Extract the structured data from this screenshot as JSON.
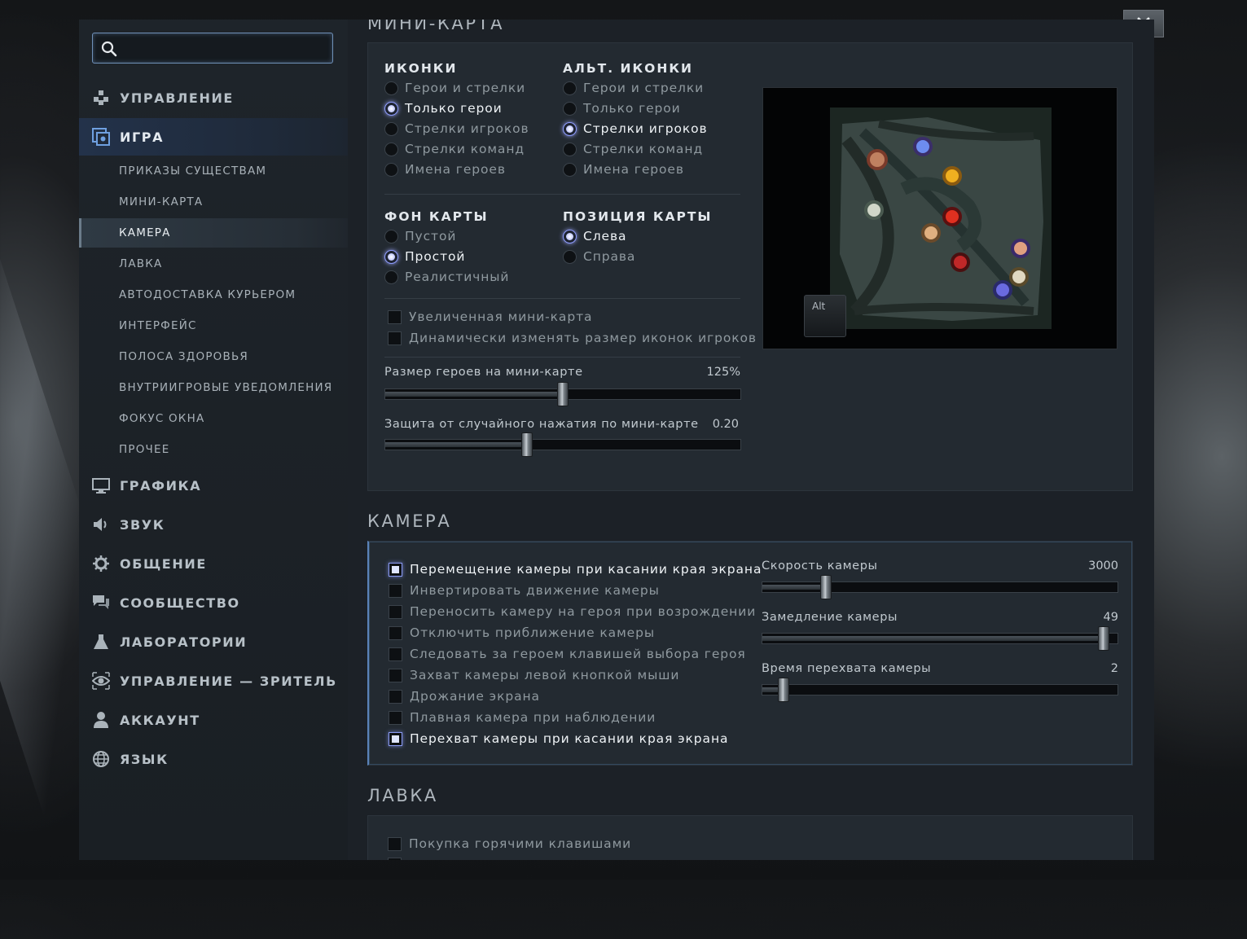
{
  "search": {
    "placeholder": "",
    "value": ""
  },
  "sidebar": {
    "categories": [
      {
        "label": "УПРАВЛЕНИЕ",
        "icon": "controls-icon"
      },
      {
        "label": "ИГРА",
        "icon": "game-icon",
        "active": true
      },
      {
        "label": "ГРАФИКА",
        "icon": "monitor-icon"
      },
      {
        "label": "ЗВУК",
        "icon": "speaker-icon"
      },
      {
        "label": "ОБЩЕНИЕ",
        "icon": "gear-icon"
      },
      {
        "label": "СООБЩЕСТВО",
        "icon": "chat-icon"
      },
      {
        "label": "ЛАБОРАТОРИИ",
        "icon": "flask-icon"
      },
      {
        "label": "УПРАВЛЕНИЕ — ЗРИТЕЛЬ",
        "icon": "eye-icon"
      },
      {
        "label": "АККАУНТ",
        "icon": "user-icon"
      },
      {
        "label": "ЯЗЫК",
        "icon": "globe-icon"
      }
    ],
    "game_subitems": [
      "ПРИКАЗЫ СУЩЕСТВАМ",
      "МИНИ-КАРТА",
      "КАМЕРА",
      "ЛАВКА",
      "АВТОДОСТАВКА КУРЬЕРОМ",
      "ИНТЕРФЕЙС",
      "ПОЛОСА ЗДОРОВЬЯ",
      "ВНУТРИИГРОВЫЕ УВЕДОМЛЕНИЯ",
      "ФОКУС ОКНА",
      "ПРОЧЕЕ"
    ],
    "selected_subitem": "КАМЕРА"
  },
  "minimap_section": {
    "title": "МИНИ-КАРТА",
    "icons": {
      "heading": "ИКОНКИ",
      "options": [
        "Герои и стрелки",
        "Только герои",
        "Стрелки игроков",
        "Стрелки команд",
        "Имена героев"
      ],
      "selected": 1
    },
    "alt_icons": {
      "heading": "АЛЬТ. ИКОНКИ",
      "options": [
        "Герои и стрелки",
        "Только герои",
        "Стрелки игроков",
        "Стрелки команд",
        "Имена героев"
      ],
      "selected": 2
    },
    "map_background": {
      "heading": "ФОН КАРТЫ",
      "options": [
        "Пустой",
        "Простой",
        "Реалистичный"
      ],
      "selected": 1
    },
    "map_position": {
      "heading": "ПОЗИЦИЯ КАРТЫ",
      "options": [
        "Слева",
        "Справа"
      ],
      "selected": 0
    },
    "checkboxes": [
      {
        "label": "Увеличенная мини-карта",
        "checked": false
      },
      {
        "label": "Динамически изменять размер иконок игроков",
        "checked": false
      }
    ],
    "sliders": [
      {
        "label": "Размер героев на мини-карте",
        "value": "125%",
        "fraction": 0.5
      },
      {
        "label": "Защита от случайного нажатия по мини-карте",
        "value": "0.20",
        "fraction": 0.4
      }
    ],
    "preview_key": "Alt"
  },
  "camera_section": {
    "title": "КАМЕРА",
    "checkboxes": [
      {
        "label": "Перемещение камеры при касании края экрана",
        "checked": true
      },
      {
        "label": "Инвертировать движение камеры",
        "checked": false
      },
      {
        "label": "Переносить камеру на героя при возрождении",
        "checked": false
      },
      {
        "label": "Отключить приближение камеры",
        "checked": false
      },
      {
        "label": "Следовать за героем клавишей выбора героя",
        "checked": false
      },
      {
        "label": "Захват камеры левой кнопкой мыши",
        "checked": false
      },
      {
        "label": "Дрожание экрана",
        "checked": false
      },
      {
        "label": "Плавная камера при наблюдении",
        "checked": false
      },
      {
        "label": "Перехват камеры при касании края экрана",
        "checked": true
      }
    ],
    "sliders": [
      {
        "label": "Скорость камеры",
        "value": "3000",
        "fraction": 0.18
      },
      {
        "label": "Замедление камеры",
        "value": "49",
        "fraction": 0.96
      },
      {
        "label": "Время перехвата камеры",
        "value": "2",
        "fraction": 0.06
      }
    ]
  },
  "shop_section": {
    "title": "ЛАВКА",
    "checkboxes": [
      {
        "label": "Покупка горячими клавишами",
        "checked": false
      }
    ]
  },
  "colors": {
    "accent": "#8e9cff",
    "panel": "#1c2127",
    "active_category": "#23324a"
  }
}
